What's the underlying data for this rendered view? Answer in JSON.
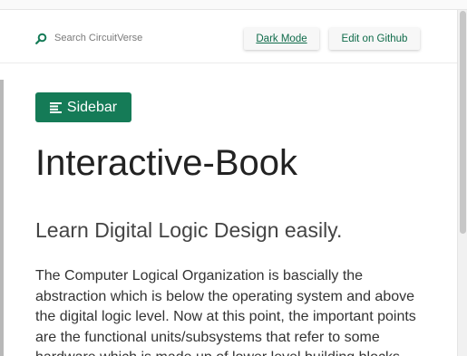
{
  "header": {
    "search_placeholder": "Search CircuitVerse",
    "dark_mode_label": "Dark Mode",
    "github_label": "Edit on Github"
  },
  "sidebar_button": {
    "label": "Sidebar",
    "icon": "menu-icon"
  },
  "main": {
    "title": "Interactive-Book",
    "subtitle": "Learn Digital Logic Design easily.",
    "paragraph": "The Computer Logical Organization is bascially the abstraction which is below the operating system and above the digital logic level. Now at this point, the important points are the functional units/subsystems that refer to some hardware which is made up of lower level building blocks."
  },
  "colors": {
    "accent": "#157b57",
    "link": "#0f6b4a"
  }
}
